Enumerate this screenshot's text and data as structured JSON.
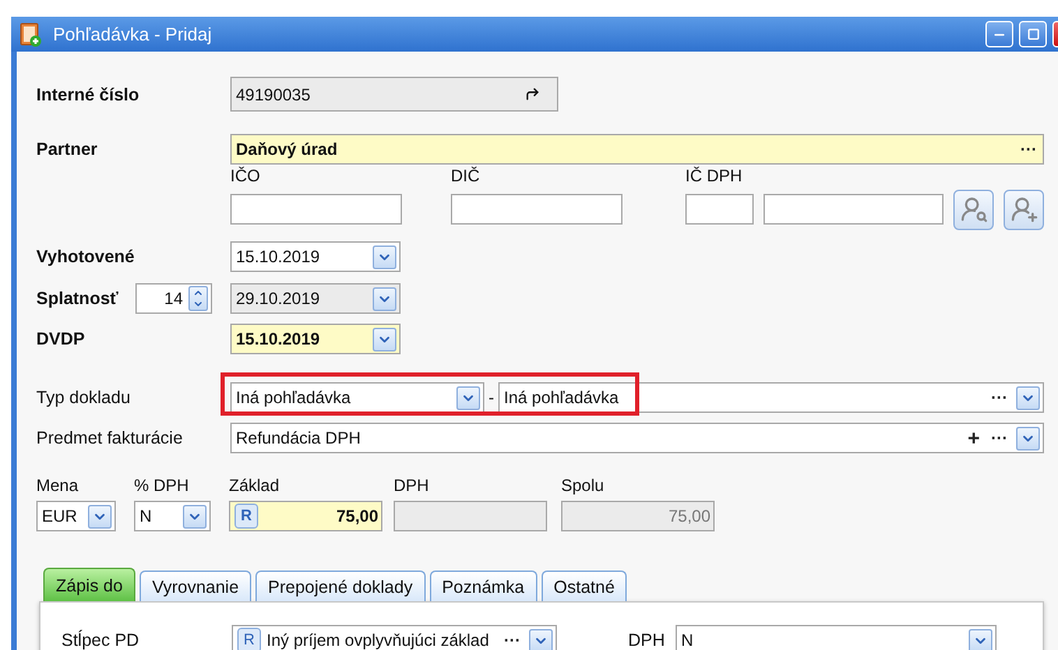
{
  "window": {
    "title": "Pohľadávka - Pridaj"
  },
  "internal_number": {
    "label": "Interné číslo",
    "value": "49190035",
    "readonly": true
  },
  "partner": {
    "label": "Partner",
    "value": "Daňový úrad",
    "highlighted": true,
    "more": "···"
  },
  "partner_ids": [
    {
      "label": "IČO"
    },
    {
      "label": "DIČ"
    },
    {
      "label": "IČ DPH"
    }
  ],
  "issued": {
    "label": "Vyhotovené",
    "value": "15.10.2019",
    "readonly": false,
    "highlighted": false
  },
  "due": {
    "label": "Splatnosť",
    "days": "14",
    "value": "29.10.2019",
    "readonly": true,
    "highlighted": false
  },
  "dvdp": {
    "label": "DVDP",
    "value": "15.10.2019",
    "highlighted": true
  },
  "doc_type": {
    "label": "Typ dokladu",
    "value": "Iná pohľadávka",
    "separator": "-",
    "name": "Iná pohľadávka",
    "more": "···",
    "framed": true
  },
  "subject": {
    "label": "Predmet fakturácie",
    "value": "Refundácia DPH",
    "add": "+",
    "more": "···"
  },
  "amounts": [
    {
      "label": "Mena",
      "value": "EUR",
      "kind": "select"
    },
    {
      "label": "% DPH",
      "value": "N",
      "kind": "select"
    },
    {
      "label": "Základ",
      "value": "75,00",
      "kind": "amount",
      "badge": "R"
    },
    {
      "label": "DPH",
      "kind": "readonly"
    },
    {
      "label": "Spolu",
      "value": "75,00",
      "kind": "readonly"
    }
  ],
  "tabs": [
    {
      "label": "Zápis do",
      "selected": true
    },
    {
      "label": "Vyrovnanie",
      "selected": false
    },
    {
      "label": "Prepojené doklady",
      "selected": false
    },
    {
      "label": "Poznámka",
      "selected": false
    },
    {
      "label": "Ostatné",
      "selected": false
    }
  ],
  "tab_panel": {
    "column": {
      "label": "Stĺpec PD",
      "badge": "R",
      "value": "Iný príjem ovplyvňujúci základ",
      "more": "···"
    },
    "vat": {
      "label": "DPH",
      "value": "N"
    }
  }
}
